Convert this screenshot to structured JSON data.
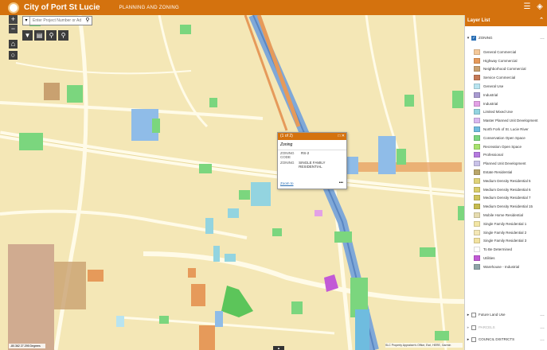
{
  "header": {
    "title": "City of Port St Lucie",
    "subtitle": "PLANNING AND ZONING",
    "list_icon": "list-icon",
    "layers_icon": "layers-icon"
  },
  "search": {
    "placeholder": "Enter Project Number or Ad"
  },
  "popup": {
    "counter": "(1 of 2)",
    "title": "Zoning",
    "rows": [
      {
        "k": "ZONING CODE",
        "v": "RS-2"
      },
      {
        "k": "ZONING",
        "v": "SINGLE FAMILY RESIDENTIAL"
      }
    ],
    "zoom_label": "Zoom to",
    "more_label": "•••"
  },
  "map": {
    "coords": "-80.362 27.295 Degrees",
    "attribution": "SLC Property Appraiser's Office, Esri, HERE, Garmin",
    "collapse_glyph": "▲"
  },
  "layer_panel": {
    "title": "Layer List",
    "zoning_layer": "ZONING",
    "legend": [
      {
        "label": "General Commercial",
        "color": "#f5c99a"
      },
      {
        "label": "Highway Commercial",
        "color": "#e69a5a"
      },
      {
        "label": "Neighborhood Commercial",
        "color": "#c9a170"
      },
      {
        "label": "Service Commercial",
        "color": "#c57a56"
      },
      {
        "label": "General Use",
        "color": "#b8e4f0"
      },
      {
        "label": "Industrial",
        "color": "#a99bd1"
      },
      {
        "label": "Industrial",
        "color": "#e3a1e6"
      },
      {
        "label": "Limited Mixed Use",
        "color": "#93d4e0"
      },
      {
        "label": "Master Planned Unit Development",
        "color": "#d9b8f0"
      },
      {
        "label": "North Fork of St. Lucie River",
        "color": "#6fbcdf"
      },
      {
        "label": "Conservation Open Space",
        "color": "#7bd67e"
      },
      {
        "label": "Recreation Open Space",
        "color": "#a8e36e"
      },
      {
        "label": "Professional",
        "color": "#b57ae0"
      },
      {
        "label": "Planned Unit Development",
        "color": "#c9c2e8"
      },
      {
        "label": "Estate Residential",
        "color": "#b9a66a"
      },
      {
        "label": "Medium Density Residential 5",
        "color": "#e0d37a"
      },
      {
        "label": "Medium Density Residential 6",
        "color": "#d9cd6a"
      },
      {
        "label": "Medium Density Residential 7",
        "color": "#cfc45c"
      },
      {
        "label": "Medium Density Residential 15",
        "color": "#c6bb4f"
      },
      {
        "label": "Mobile Home Residential",
        "color": "#e6dcb0"
      },
      {
        "label": "Single Family Residential 1",
        "color": "#f3e6a5"
      },
      {
        "label": "Single Family Residential 2",
        "color": "#f4e7b6"
      },
      {
        "label": "Single Family Residential 3",
        "color": "#f2e2a0"
      },
      {
        "label": "To Be Determined",
        "color": "#ffffff"
      },
      {
        "label": "Utilities",
        "color": "#c25ad6"
      },
      {
        "label": "Warehouse - Industrial",
        "color": "#8fa5a8"
      }
    ],
    "other_layers": [
      "Future Land Use",
      "PARCELS",
      "COUNCIL DISTRICTS"
    ]
  }
}
